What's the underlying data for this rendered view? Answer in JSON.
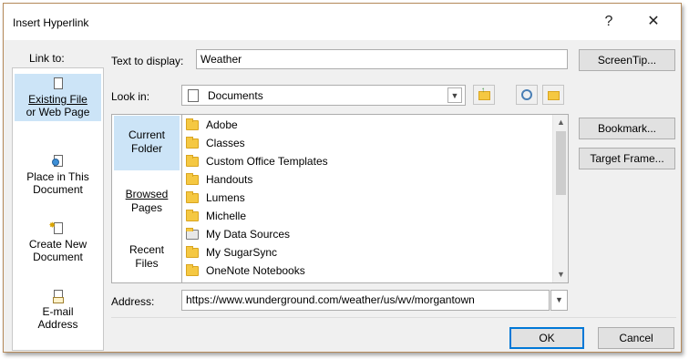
{
  "window": {
    "title": "Insert Hyperlink",
    "help_glyph": "?",
    "close_glyph": "✕"
  },
  "link_to": {
    "label": "Link to:",
    "items": [
      {
        "label_line1": "Existing File",
        "label_line2": "or Web Page",
        "icon": "existing-file-icon"
      },
      {
        "label_line1": "Place in This",
        "label_line2": "Document",
        "icon": "place-in-document-icon"
      },
      {
        "label_line1": "Create New",
        "label_line2": "Document",
        "icon": "create-new-document-icon"
      },
      {
        "label_line1": "E-mail",
        "label_line2": "Address",
        "icon": "email-address-icon"
      }
    ]
  },
  "text_to_display": {
    "label": "Text to display:",
    "value": "Weather"
  },
  "screentip_button": "ScreenTip...",
  "look_in": {
    "label": "Look in:",
    "value": "Documents",
    "icon": "documents-icon"
  },
  "toolbar_icons": [
    "up-one-folder-icon",
    "browse-web-icon",
    "browse-file-icon"
  ],
  "nav": {
    "items": [
      {
        "line1": "Current",
        "line2": "Folder"
      },
      {
        "line1": "Browsed",
        "line2": "Pages"
      },
      {
        "line1": "Recent",
        "line2": "Files"
      }
    ]
  },
  "files": [
    {
      "name": "Adobe",
      "icon": "folder-icon"
    },
    {
      "name": "Classes",
      "icon": "folder-icon"
    },
    {
      "name": "Custom Office Templates",
      "icon": "folder-icon"
    },
    {
      "name": "Handouts",
      "icon": "folder-icon"
    },
    {
      "name": "Lumens",
      "icon": "folder-icon"
    },
    {
      "name": "Michelle",
      "icon": "folder-icon"
    },
    {
      "name": "My Data Sources",
      "icon": "data-sources-folder-icon"
    },
    {
      "name": "My SugarSync",
      "icon": "folder-icon"
    },
    {
      "name": "OneNote Notebooks",
      "icon": "folder-icon"
    }
  ],
  "side_buttons": {
    "bookmark": "Bookmark...",
    "target_frame": "Target Frame..."
  },
  "address": {
    "label": "Address:",
    "value": "https://www.wunderground.com/weather/us/wv/morgantown"
  },
  "footer": {
    "ok": "OK",
    "cancel": "Cancel"
  },
  "colors": {
    "selection": "#cce4f7",
    "accent": "#0078d7",
    "dialog_bg": "#f0f0f0",
    "folder": "#f5c842"
  }
}
